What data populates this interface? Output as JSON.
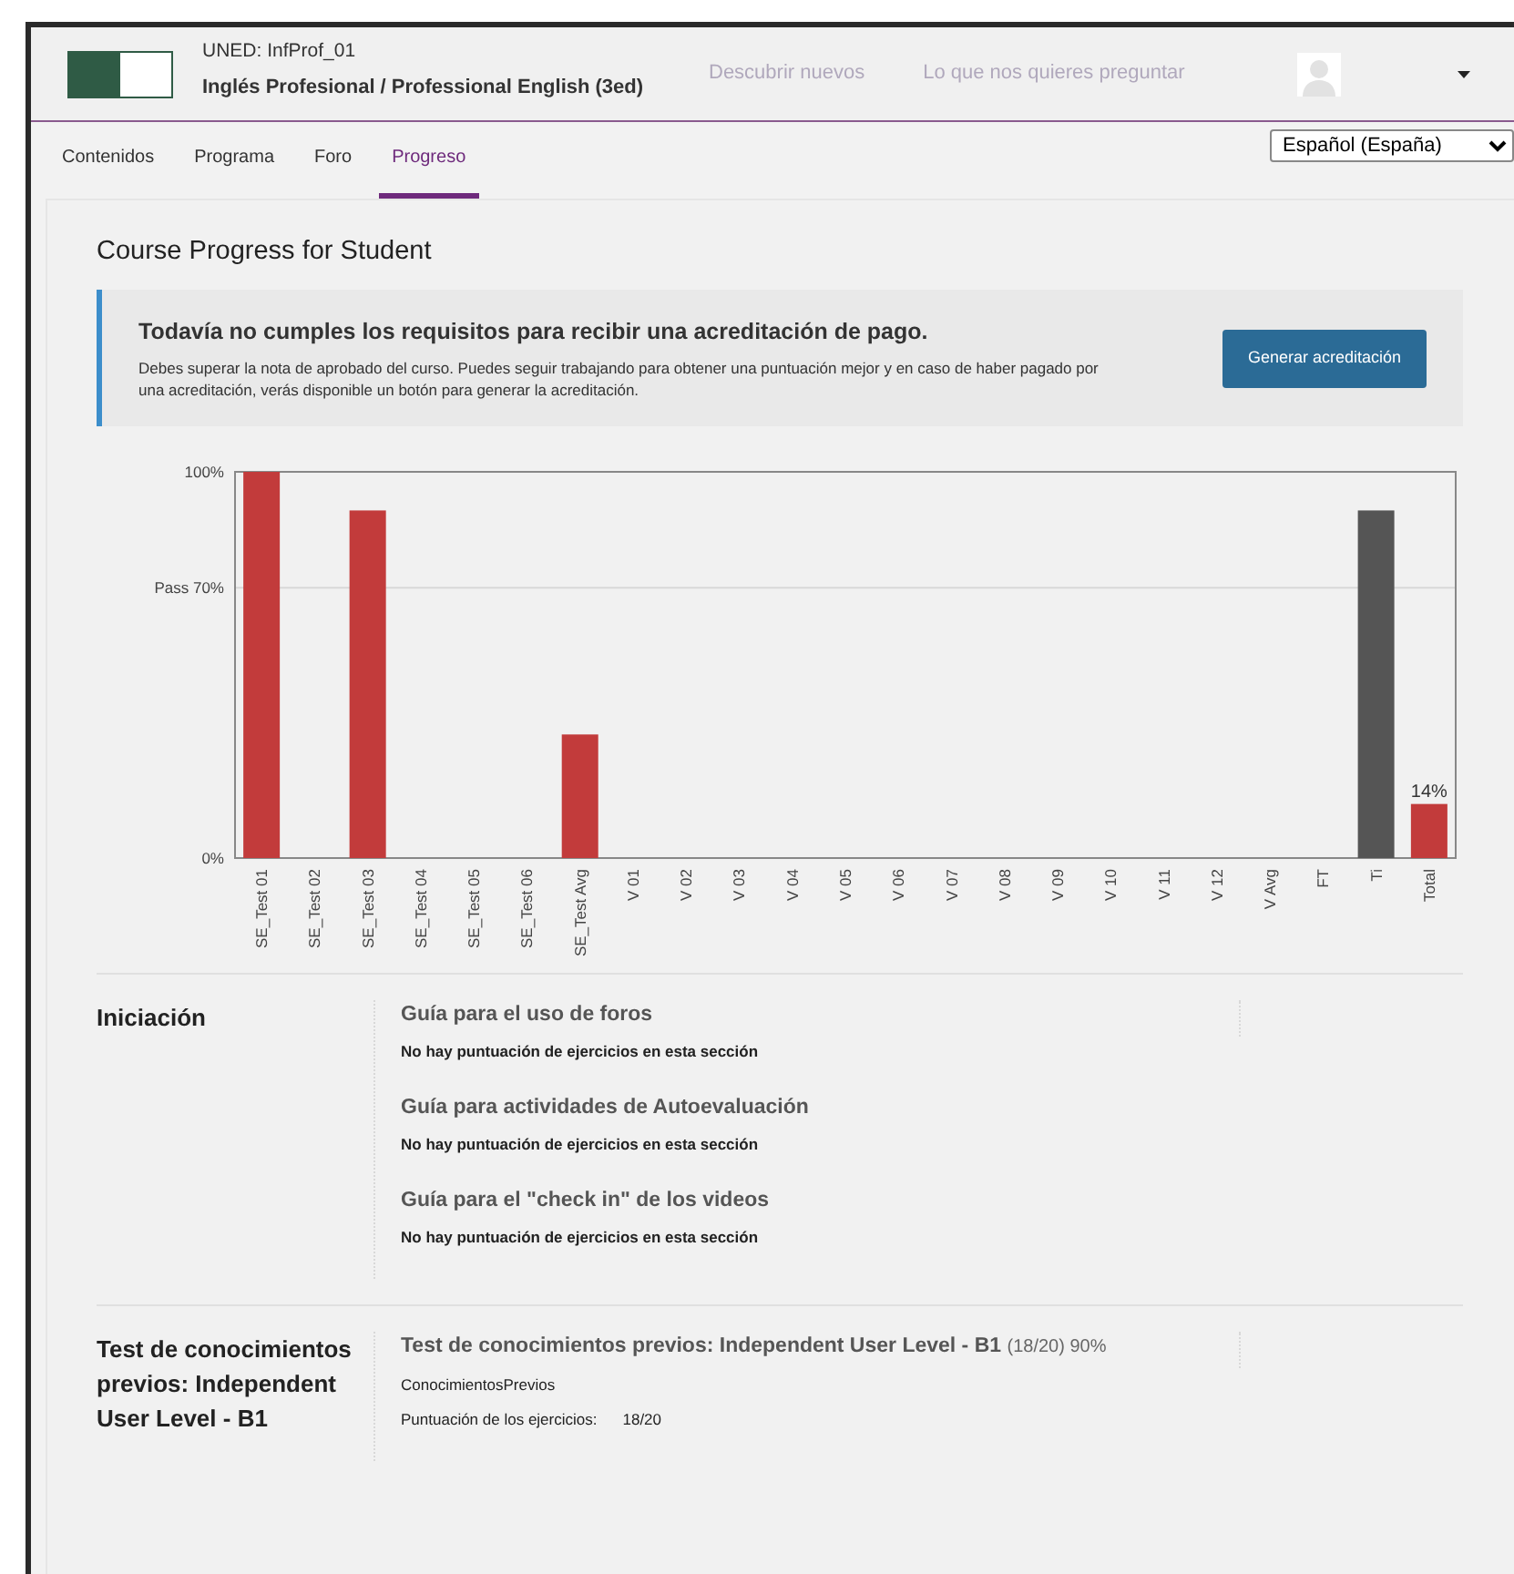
{
  "header": {
    "org": "UNED: InfProf_01",
    "course": "Inglés Profesional / Professional English (3ed)",
    "links": [
      "Descubrir nuevos",
      "Lo que nos quieres preguntar"
    ]
  },
  "tabs": [
    {
      "label": "Contenidos",
      "selected": false
    },
    {
      "label": "Programa",
      "selected": false
    },
    {
      "label": "Foro",
      "selected": false
    },
    {
      "label": "Progreso",
      "selected": true
    }
  ],
  "language_select": {
    "value": "Español (España)"
  },
  "page_title": "Course Progress for Student",
  "notice": {
    "title": "Todavía no cumples los requisitos para recibir una acreditación de pago.",
    "text": "Debes superar la nota de aprobado del curso. Puedes seguir trabajando para obtener una puntuación mejor y en caso de haber pagado por una acreditación, verás disponible un botón para generar la acreditación.",
    "button": "Generar acreditación"
  },
  "chart_data": {
    "type": "bar",
    "categories": [
      "SE_Test 01",
      "SE_Test 02",
      "SE_Test 03",
      "SE_Test 04",
      "SE_Test 05",
      "SE_Test 06",
      "SE_Test Avg",
      "V 01",
      "V 02",
      "V 03",
      "V 04",
      "V 05",
      "V 06",
      "V 07",
      "V 08",
      "V 09",
      "V 10",
      "V 11",
      "V 12",
      "V Avg",
      "FT",
      "Ti",
      "Total"
    ],
    "series": [
      {
        "color": "#c23b3b",
        "values": [
          100,
          0,
          90,
          0,
          0,
          0,
          32,
          0,
          0,
          0,
          0,
          0,
          0,
          0,
          0,
          0,
          0,
          0,
          0,
          0,
          0,
          null,
          14
        ]
      },
      {
        "color": "#555555",
        "values": [
          null,
          null,
          null,
          null,
          null,
          null,
          null,
          null,
          null,
          null,
          null,
          null,
          null,
          null,
          null,
          null,
          null,
          null,
          null,
          null,
          null,
          90,
          null
        ]
      }
    ],
    "ylim": [
      0,
      100
    ],
    "yticks": [
      {
        "value": 0,
        "label": "0%"
      },
      {
        "value": 70,
        "label": "Pass 70%"
      },
      {
        "value": 100,
        "label": "100%"
      }
    ],
    "annotations": [
      "14%"
    ]
  },
  "sections": [
    {
      "title": "Iniciación",
      "subsections": [
        {
          "title": "Guía para el uso de foros",
          "note": "No hay puntuación de ejercicios en esta sección"
        },
        {
          "title": "Guía para actividades de Autoevaluación",
          "note": "No hay puntuación de ejercicios en esta sección"
        },
        {
          "title": "Guía para el \"check in\" de los videos",
          "note": "No hay puntuación de ejercicios en esta sección"
        }
      ]
    },
    {
      "title": "Test de conocimientos previos: Independent User Level - B1",
      "subsections": [
        {
          "title": "Test de conocimientos previos: Independent User Level - B1",
          "score": "(18/20) 90%",
          "problem_set": "ConocimientosPrevios",
          "scores_label": "Puntuación de los ejercicios:",
          "scores": "18/20"
        }
      ]
    }
  ]
}
